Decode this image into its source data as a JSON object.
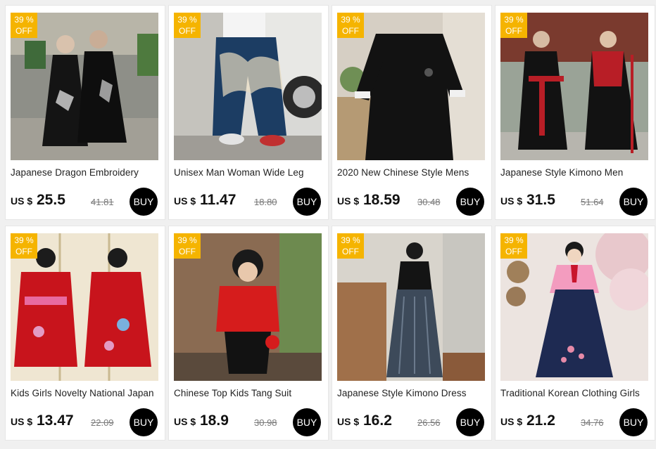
{
  "colors": {
    "badge": "#f5b400",
    "buy_button": "#000000"
  },
  "products": [
    {
      "badge_pct": "39 %",
      "badge_off": "OFF",
      "title": "Japanese Dragon Embroidery",
      "currency": "US $",
      "price": "25.5",
      "old_price": "41.81",
      "buy_label": "BUY"
    },
    {
      "badge_pct": "39 %",
      "badge_off": "OFF",
      "title": "Unisex Man Woman Wide Leg",
      "currency": "US $",
      "price": "11.47",
      "old_price": "18.80",
      "buy_label": "BUY"
    },
    {
      "badge_pct": "39 %",
      "badge_off": "OFF",
      "title": "2020 New Chinese Style Mens",
      "currency": "US $",
      "price": "18.59",
      "old_price": "30.48",
      "buy_label": "BUY"
    },
    {
      "badge_pct": "39 %",
      "badge_off": "OFF",
      "title": "Japanese Style Kimono Men",
      "currency": "US $",
      "price": "31.5",
      "old_price": "51.64",
      "buy_label": "BUY"
    },
    {
      "badge_pct": "39 %",
      "badge_off": "OFF",
      "title": "Kids Girls Novelty National Japan",
      "currency": "US $",
      "price": "13.47",
      "old_price": "22.09",
      "buy_label": "BUY"
    },
    {
      "badge_pct": "39 %",
      "badge_off": "OFF",
      "title": "Chinese Top Kids Tang Suit",
      "currency": "US $",
      "price": "18.9",
      "old_price": "30.98",
      "buy_label": "BUY"
    },
    {
      "badge_pct": "39 %",
      "badge_off": "OFF",
      "title": "Japanese Style Kimono Dress",
      "currency": "US $",
      "price": "16.2",
      "old_price": "26.56",
      "buy_label": "BUY"
    },
    {
      "badge_pct": "39 %",
      "badge_off": "OFF",
      "title": "Traditional Korean Clothing Girls",
      "currency": "US $",
      "price": "21.2",
      "old_price": "34.76",
      "buy_label": "BUY"
    }
  ]
}
